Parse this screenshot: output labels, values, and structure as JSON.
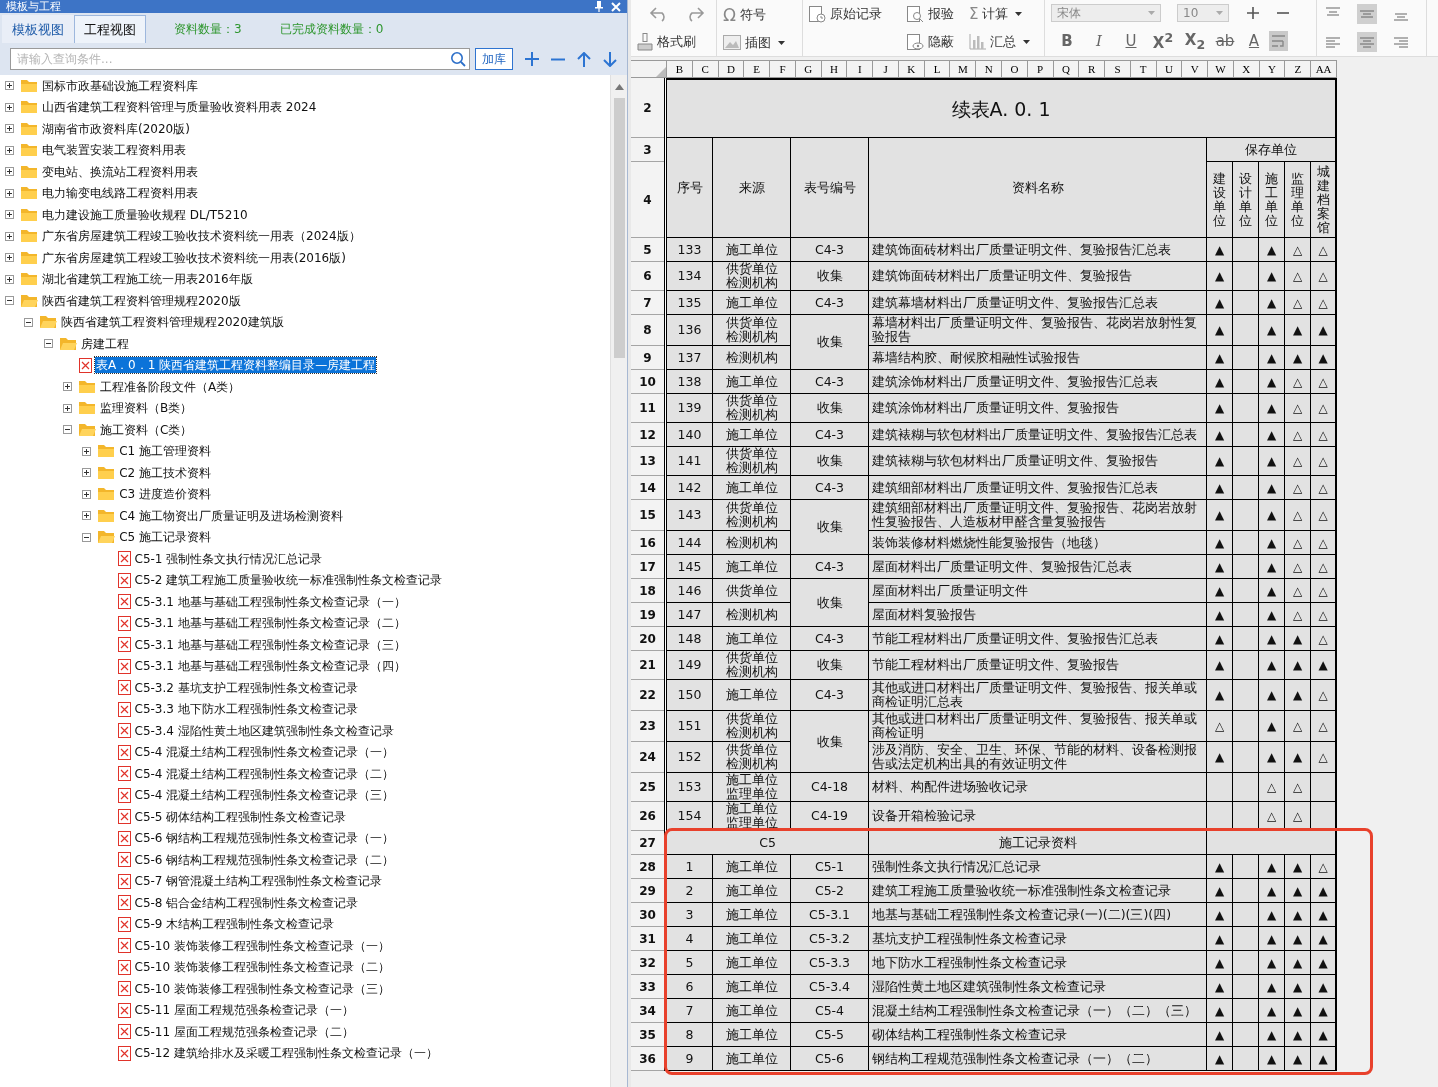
{
  "left": {
    "title": "模板与工程",
    "tabs": [
      {
        "label": "模板视图",
        "selected": true
      },
      {
        "label": "工程视图",
        "selected": false
      }
    ],
    "stats": [
      "资料数量：3",
      "已完成资料数量：0"
    ],
    "search": {
      "placeholder": "请输入查询条件..."
    },
    "add_button": "加库"
  },
  "tree": {
    "items": [
      {
        "label": "国标市政基础设施工程资料库",
        "kind": "folder",
        "expanded": false,
        "selected": false
      },
      {
        "label": "山西省建筑工程资料管理与质量验收资料用表 2024",
        "kind": "folder",
        "expanded": false,
        "selected": false
      },
      {
        "label": "湖南省市政资料库(2020版)",
        "kind": "folder",
        "expanded": false,
        "selected": false
      },
      {
        "label": "电气装置安装工程资料用表",
        "kind": "folder",
        "expanded": false,
        "selected": false
      },
      {
        "label": "变电站、换流站工程资料用表",
        "kind": "folder",
        "expanded": false,
        "selected": false
      },
      {
        "label": "电力输变电线路工程资料用表",
        "kind": "folder",
        "expanded": false,
        "selected": false
      },
      {
        "label": "电力建设施工质量验收规程 DL/T5210",
        "kind": "folder",
        "expanded": false,
        "selected": false
      },
      {
        "label": "广东省房屋建筑工程竣工验收技术资料统一用表（2024版）",
        "kind": "folder",
        "expanded": false,
        "selected": false
      },
      {
        "label": "广东省房屋建筑工程竣工验收技术资料统一用表(2016版)",
        "kind": "folder",
        "expanded": false,
        "selected": false
      },
      {
        "label": "湖北省建筑工程施工统一用表2016年版",
        "kind": "folder",
        "expanded": false,
        "selected": false
      },
      {
        "label": "陕西省建筑工程资料管理规程2020版",
        "kind": "folder",
        "expanded": true,
        "selected": false,
        "children": [
          {
            "label": "陕西省建筑工程资料管理规程2020建筑版",
            "kind": "folder",
            "expanded": true,
            "selected": false,
            "children": [
              {
                "label": "房建工程",
                "kind": "folder",
                "expanded": true,
                "selected": false,
                "children": [
                  {
                    "label": "表A．0．1 陕西省建筑工程资料整编目录—房建工程",
                    "kind": "file",
                    "selected": true
                  },
                  {
                    "label": "工程准备阶段文件（A类）",
                    "kind": "folder",
                    "expanded": false,
                    "selected": false
                  },
                  {
                    "label": "监理资料（B类）",
                    "kind": "folder",
                    "expanded": false,
                    "selected": false
                  },
                  {
                    "label": "施工资料（C类）",
                    "kind": "folder",
                    "expanded": true,
                    "selected": false,
                    "children": [
                      {
                        "label": "C1 施工管理资料",
                        "kind": "folder",
                        "expanded": false,
                        "selected": false
                      },
                      {
                        "label": "C2 施工技术资料",
                        "kind": "folder",
                        "expanded": false,
                        "selected": false
                      },
                      {
                        "label": "C3 进度造价资料",
                        "kind": "folder",
                        "expanded": false,
                        "selected": false
                      },
                      {
                        "label": "C4 施工物资出厂质量证明及进场检测资料",
                        "kind": "folder",
                        "expanded": false,
                        "selected": false
                      },
                      {
                        "label": "C5 施工记录资料",
                        "kind": "folder",
                        "expanded": true,
                        "selected": false,
                        "children": [
                          {
                            "label": "C5-1 强制性条文执行情况汇总记录",
                            "kind": "file",
                            "selected": false
                          },
                          {
                            "label": "C5-2 建筑工程施工质量验收统一标准强制性条文检查记录",
                            "kind": "file",
                            "selected": false
                          },
                          {
                            "label": "C5-3.1 地基与基础工程强制性条文检查记录（一）",
                            "kind": "file",
                            "selected": false
                          },
                          {
                            "label": "C5-3.1 地基与基础工程强制性条文检查记录（二）",
                            "kind": "file",
                            "selected": false
                          },
                          {
                            "label": "C5-3.1 地基与基础工程强制性条文检查记录（三）",
                            "kind": "file",
                            "selected": false
                          },
                          {
                            "label": "C5-3.1 地基与基础工程强制性条文检查记录（四）",
                            "kind": "file",
                            "selected": false
                          },
                          {
                            "label": "C5-3.2 基坑支护工程强制性条文检查记录",
                            "kind": "file",
                            "selected": false
                          },
                          {
                            "label": "C5-3.3 地下防水工程强制性条文检查记录",
                            "kind": "file",
                            "selected": false
                          },
                          {
                            "label": "C5-3.4 湿陷性黄土地区建筑强制性条文检查记录",
                            "kind": "file",
                            "selected": false
                          },
                          {
                            "label": "C5-4 混凝土结构工程强制性条文检查记录（一）",
                            "kind": "file",
                            "selected": false
                          },
                          {
                            "label": "C5-4 混凝土结构工程强制性条文检查记录（二）",
                            "kind": "file",
                            "selected": false
                          },
                          {
                            "label": "C5-4 混凝土结构工程强制性条文检查记录（三）",
                            "kind": "file",
                            "selected": false
                          },
                          {
                            "label": "C5-5 砌体结构工程强制性条文检查记录",
                            "kind": "file",
                            "selected": false
                          },
                          {
                            "label": "C5-6 钢结构工程规范强制性条文检查记录（一）",
                            "kind": "file",
                            "selected": false
                          },
                          {
                            "label": "C5-6 钢结构工程规范强制性条文检查记录（二）",
                            "kind": "file",
                            "selected": false
                          },
                          {
                            "label": "C5-7 钢管混凝土结构工程强制性条文检查记录",
                            "kind": "file",
                            "selected": false
                          },
                          {
                            "label": "C5-8 铝合金结构工程强制性条文检查记录",
                            "kind": "file",
                            "selected": false
                          },
                          {
                            "label": "C5-9 木结构工程强制性条文检查记录",
                            "kind": "file",
                            "selected": false
                          },
                          {
                            "label": "C5-10 装饰装修工程强制性条文检查记录（一）",
                            "kind": "file",
                            "selected": false
                          },
                          {
                            "label": "C5-10 装饰装修工程强制性条文检查记录（二）",
                            "kind": "file",
                            "selected": false
                          },
                          {
                            "label": "C5-10 装饰装修工程强制性条文检查记录（三）",
                            "kind": "file",
                            "selected": false
                          },
                          {
                            "label": "C5-11 屋面工程规范强条检查记录（一）",
                            "kind": "file",
                            "selected": false
                          },
                          {
                            "label": "C5-11 屋面工程规范强条检查记录（二）",
                            "kind": "file",
                            "selected": false
                          },
                          {
                            "label": "C5-12 建筑给排水及采暖工程强制性条文检查记录（一）",
                            "kind": "file",
                            "selected": false
                          }
                        ]
                      }
                    ]
                  }
                ]
              }
            ]
          }
        ]
      }
    ]
  },
  "toolbar": {
    "symbol_icon": "Ω",
    "symbol": "符号",
    "format_painter": "格式刷",
    "insert_image": "插图",
    "original_record": "原始记录",
    "inspection": "报验",
    "concealed": "隐蔽",
    "calculate_icon": "Σ",
    "calculate": "计算",
    "summary": "汇总",
    "font": "宋体",
    "font_size": "10",
    "bold": "B",
    "italic": "I",
    "underline": "U",
    "superscript": "X$^{2}$",
    "subscript": "X$_{2}$",
    "strikethrough": "ab",
    "font_color": "A"
  },
  "sheet": {
    "column_letters": [
      "B",
      "C",
      "D",
      "E",
      "F",
      "G",
      "H",
      "I",
      "J",
      "K",
      "L",
      "M",
      "N",
      "O",
      "P",
      "Q",
      "R",
      "S",
      "T",
      "U",
      "V",
      "W",
      "X",
      "Y",
      "Z",
      "AA"
    ],
    "title_row": {
      "row_number": "2",
      "title": "续表A. 0. 1"
    },
    "header": {
      "row_numbers": [
        "3",
        "4"
      ],
      "no": "序号",
      "source": "来源",
      "code": "表号编号",
      "name": "资料名称",
      "storage": "保存单位",
      "units": [
        "建设单位",
        "设计单位",
        "施工单位",
        "监理单位",
        "城建档案馆"
      ]
    },
    "groups": [
      {
        "kind": "group",
        "code": "C4-3",
        "rows": [
          {
            "row_number": "5",
            "no": "133",
            "source": "施工单位",
            "name": "建筑饰面砖材料出厂质量证明文件、复验报告汇总表",
            "marks": {
              "owner": "▲",
              "contractor": "▲",
              "supervisor": "△",
              "archive": "△"
            }
          }
        ]
      },
      {
        "kind": "group",
        "code": "收集",
        "rows": [
          {
            "row_number": "6",
            "no": "134",
            "source": "供货单位检测机构",
            "name": "建筑饰面砖材料出厂质量证明文件、复验报告",
            "marks": {
              "owner": "▲",
              "contractor": "▲",
              "supervisor": "△",
              "archive": "△"
            }
          }
        ]
      },
      {
        "kind": "group",
        "code": "C4-3",
        "rows": [
          {
            "row_number": "7",
            "no": "135",
            "source": "施工单位",
            "name": "建筑幕墙材料出厂质量证明文件、复验报告汇总表",
            "marks": {
              "owner": "▲",
              "contractor": "▲",
              "supervisor": "△",
              "archive": "△"
            }
          }
        ]
      },
      {
        "kind": "group",
        "code": "收集",
        "rows": [
          {
            "row_number": "8",
            "no": "136",
            "source": "供货单位检测机构",
            "name": "幕墙材料出厂质量证明文件、复验报告、花岗岩放射性复验报告",
            "marks": {
              "owner": "▲",
              "contractor": "▲",
              "supervisor": "▲",
              "archive": "▲"
            }
          },
          {
            "row_number": "9",
            "no": "137",
            "source": "检测机构",
            "name": "幕墙结构胶、耐候胶相融性试验报告",
            "marks": {
              "owner": "▲",
              "contractor": "▲",
              "supervisor": "▲",
              "archive": "▲"
            }
          }
        ]
      },
      {
        "kind": "group",
        "code": "C4-3",
        "rows": [
          {
            "row_number": "10",
            "no": "138",
            "source": "施工单位",
            "name": "建筑涂饰材料出厂质量证明文件、复验报告汇总表",
            "marks": {
              "owner": "▲",
              "contractor": "▲",
              "supervisor": "△",
              "archive": "△"
            }
          }
        ]
      },
      {
        "kind": "group",
        "code": "收集",
        "rows": [
          {
            "row_number": "11",
            "no": "139",
            "source": "供货单位检测机构",
            "name": "建筑涂饰材料出厂质量证明文件、复验报告",
            "marks": {
              "owner": "▲",
              "contractor": "▲",
              "supervisor": "△",
              "archive": "△"
            }
          }
        ]
      },
      {
        "kind": "group",
        "code": "C4-3",
        "rows": [
          {
            "row_number": "12",
            "no": "140",
            "source": "施工单位",
            "name": "建筑裱糊与软包材料出厂质量证明文件、复验报告汇总表",
            "marks": {
              "owner": "▲",
              "contractor": "▲",
              "supervisor": "△",
              "archive": "△"
            }
          }
        ]
      },
      {
        "kind": "group",
        "code": "收集",
        "rows": [
          {
            "row_number": "13",
            "no": "141",
            "source": "供货单位检测机构",
            "name": "建筑裱糊与软包材料出厂质量证明文件、复验报告",
            "marks": {
              "owner": "▲",
              "contractor": "▲",
              "supervisor": "△",
              "archive": "△"
            }
          }
        ]
      },
      {
        "kind": "group",
        "code": "C4-3",
        "rows": [
          {
            "row_number": "14",
            "no": "142",
            "source": "施工单位",
            "name": "建筑细部材料出厂质量证明文件、复验报告汇总表",
            "marks": {
              "owner": "▲",
              "contractor": "▲",
              "supervisor": "△",
              "archive": "△"
            }
          }
        ]
      },
      {
        "kind": "group",
        "code": "收集",
        "rows": [
          {
            "row_number": "15",
            "no": "143",
            "source": "供货单位检测机构",
            "name": "建筑细部材料出厂质量证明文件、复验报告、花岗岩放射性复验报告、人造板材甲醛含量复验报告",
            "marks": {
              "owner": "▲",
              "contractor": "▲",
              "supervisor": "△",
              "archive": "△"
            }
          },
          {
            "row_number": "16",
            "no": "144",
            "source": "检测机构",
            "name": "装饰装修材料燃烧性能复验报告（地毯）",
            "marks": {
              "owner": "▲",
              "contractor": "▲",
              "supervisor": "△",
              "archive": "△"
            }
          }
        ]
      },
      {
        "kind": "group",
        "code": "C4-3",
        "rows": [
          {
            "row_number": "17",
            "no": "145",
            "source": "施工单位",
            "name": "屋面材料出厂质量证明文件、复验报告汇总表",
            "marks": {
              "owner": "▲",
              "contractor": "▲",
              "supervisor": "△",
              "archive": "△"
            }
          }
        ]
      },
      {
        "kind": "group",
        "code": "收集",
        "rows": [
          {
            "row_number": "18",
            "no": "146",
            "source": "供货单位",
            "name": "屋面材料出厂质量证明文件",
            "marks": {
              "owner": "▲",
              "contractor": "▲",
              "supervisor": "△",
              "archive": "△"
            }
          },
          {
            "row_number": "19",
            "no": "147",
            "source": "检测机构",
            "name": "屋面材料复验报告",
            "marks": {
              "owner": "▲",
              "contractor": "▲",
              "supervisor": "△",
              "archive": "△"
            }
          }
        ]
      },
      {
        "kind": "group",
        "code": "C4-3",
        "rows": [
          {
            "row_number": "20",
            "no": "148",
            "source": "施工单位",
            "name": "节能工程材料出厂质量证明文件、复验报告汇总表",
            "marks": {
              "owner": "▲",
              "contractor": "▲",
              "supervisor": "▲",
              "archive": "△"
            }
          }
        ]
      },
      {
        "kind": "group",
        "code": "收集",
        "rows": [
          {
            "row_number": "21",
            "no": "149",
            "source": "供货单位检测机构",
            "name": "节能工程材料出厂质量证明文件、复验报告",
            "marks": {
              "owner": "▲",
              "contractor": "▲",
              "supervisor": "▲",
              "archive": "▲"
            }
          }
        ]
      },
      {
        "kind": "group",
        "code": "C4-3",
        "rows": [
          {
            "row_number": "22",
            "no": "150",
            "source": "施工单位",
            "name": "其他或进口材料出厂质量证明文件、复验报告、报关单或商检证明汇总表",
            "marks": {
              "owner": "▲",
              "contractor": "▲",
              "supervisor": "▲",
              "archive": "△"
            }
          }
        ]
      },
      {
        "kind": "group",
        "code": "收集",
        "rows": [
          {
            "row_number": "23",
            "no": "151",
            "source": "供货单位检测机构",
            "name": "其他或进口材料出厂质量证明文件、复验报告、报关单或商检证明",
            "marks": {
              "owner": "△",
              "contractor": "▲",
              "supervisor": "△",
              "archive": "△"
            }
          },
          {
            "row_number": "24",
            "no": "152",
            "source": "供货单位检测机构",
            "name": "涉及消防、安全、卫生、环保、节能的材料、设备检测报告或法定机构出具的有效证明文件",
            "marks": {
              "owner": "▲",
              "contractor": "▲",
              "supervisor": "▲",
              "archive": "△"
            }
          }
        ]
      },
      {
        "kind": "group",
        "code": "C4-18",
        "rows": [
          {
            "row_number": "25",
            "no": "153",
            "source": "施工单位监理单位",
            "name": "材料、构配件进场验收记录",
            "marks": {
              "contractor": "△",
              "supervisor": "△"
            }
          }
        ]
      },
      {
        "kind": "group",
        "code": "C4-19",
        "rows": [
          {
            "row_number": "26",
            "no": "154",
            "source": "施工单位监理单位",
            "name": "设备开箱检验记录",
            "marks": {
              "contractor": "△",
              "supervisor": "△"
            }
          }
        ]
      },
      {
        "kind": "section",
        "row_number": "27",
        "code": "C5",
        "name": "施工记录资料"
      },
      {
        "kind": "group",
        "code": "C5-1",
        "rows": [
          {
            "row_number": "28",
            "no": "1",
            "source": "施工单位",
            "name": "强制性条文执行情况汇总记录",
            "marks": {
              "owner": "▲",
              "contractor": "▲",
              "supervisor": "▲",
              "archive": "△"
            }
          }
        ]
      },
      {
        "kind": "group",
        "code": "C5-2",
        "rows": [
          {
            "row_number": "29",
            "no": "2",
            "source": "施工单位",
            "name": "建筑工程施工质量验收统一标准强制性条文检查记录",
            "marks": {
              "owner": "▲",
              "contractor": "▲",
              "supervisor": "▲",
              "archive": "▲"
            }
          }
        ]
      },
      {
        "kind": "group",
        "code": "C5-3.1",
        "rows": [
          {
            "row_number": "30",
            "no": "3",
            "source": "施工单位",
            "name": "地基与基础工程强制性条文检查记录(一)(二)(三)(四)",
            "marks": {
              "owner": "▲",
              "contractor": "▲",
              "supervisor": "▲",
              "archive": "▲"
            }
          }
        ]
      },
      {
        "kind": "group",
        "code": "C5-3.2",
        "rows": [
          {
            "row_number": "31",
            "no": "4",
            "source": "施工单位",
            "name": "基坑支护工程强制性条文检查记录",
            "marks": {
              "owner": "▲",
              "contractor": "▲",
              "supervisor": "▲",
              "archive": "▲"
            }
          }
        ]
      },
      {
        "kind": "group",
        "code": "C5-3.3",
        "rows": [
          {
            "row_number": "32",
            "no": "5",
            "source": "施工单位",
            "name": "地下防水工程强制性条文检查记录",
            "marks": {
              "owner": "▲",
              "contractor": "▲",
              "supervisor": "▲",
              "archive": "▲"
            }
          }
        ]
      },
      {
        "kind": "group",
        "code": "C5-3.4",
        "rows": [
          {
            "row_number": "33",
            "no": "6",
            "source": "施工单位",
            "name": "湿陷性黄土地区建筑强制性条文检查记录",
            "marks": {
              "owner": "▲",
              "contractor": "▲",
              "supervisor": "▲",
              "archive": "▲"
            }
          }
        ]
      },
      {
        "kind": "group",
        "code": "C5-4",
        "rows": [
          {
            "row_number": "34",
            "no": "7",
            "source": "施工单位",
            "name": "混凝土结构工程强制性条文检查记录（一）（二）（三）",
            "marks": {
              "owner": "▲",
              "contractor": "▲",
              "supervisor": "▲",
              "archive": "▲"
            }
          }
        ]
      },
      {
        "kind": "group",
        "code": "C5-5",
        "rows": [
          {
            "row_number": "35",
            "no": "8",
            "source": "施工单位",
            "name": "砌体结构工程强制性条文检查记录",
            "marks": {
              "owner": "▲",
              "contractor": "▲",
              "supervisor": "▲",
              "archive": "▲"
            }
          }
        ]
      },
      {
        "kind": "group",
        "code": "C5-6",
        "rows": [
          {
            "row_number": "36",
            "no": "9",
            "source": "施工单位",
            "name": "钢结构工程规范强制性条文检查记录（一）（二）",
            "marks": {
              "owner": "▲",
              "contractor": "▲",
              "supervisor": "▲",
              "archive": "▲"
            }
          }
        ]
      }
    ]
  }
}
